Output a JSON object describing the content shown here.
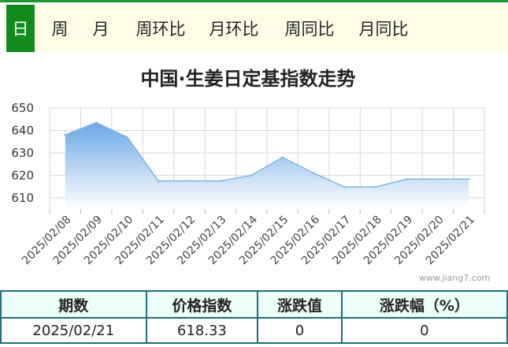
{
  "tabs": [
    {
      "label": "日",
      "active": true
    },
    {
      "label": "周",
      "active": false
    },
    {
      "label": "月",
      "active": false
    },
    {
      "label": "周环比",
      "active": false
    },
    {
      "label": "月环比",
      "active": false
    },
    {
      "label": "周同比",
      "active": false
    },
    {
      "label": "月同比",
      "active": false
    }
  ],
  "watermark": "www.jiang7.com",
  "colors": {
    "accent": "#138a1c",
    "line": "#7fb3e0",
    "table_border": "#1f6f78",
    "table_header_bg": "#edfdf8",
    "tab_bar_bg": "#fdfde6"
  },
  "chart_data": {
    "type": "area",
    "title": "中国·生姜日定基指数走势",
    "xlabel": "",
    "ylabel": "",
    "categories": [
      "2025/02/08",
      "2025/02/09",
      "2025/02/10",
      "2025/02/11",
      "2025/02/12",
      "2025/02/13",
      "2025/02/14",
      "2025/02/15",
      "2025/02/16",
      "2025/02/17",
      "2025/02/18",
      "2025/02/19",
      "2025/02/20",
      "2025/02/21"
    ],
    "series": [
      {
        "values": [
          638,
          643.5,
          637,
          617.5,
          617.5,
          617.5,
          620,
          628,
          621,
          614.8,
          614.8,
          618.33,
          618.33,
          618.33
        ]
      }
    ],
    "ylim": [
      605,
      650
    ],
    "yticks": [
      610,
      620,
      630,
      640,
      650
    ],
    "grid": true,
    "legend": "none"
  },
  "table": {
    "headers": [
      "期数",
      "价格指数",
      "涨跌值",
      "涨跌幅（%）"
    ],
    "row": [
      "2025/02/21",
      "618.33",
      "0",
      "0"
    ]
  }
}
